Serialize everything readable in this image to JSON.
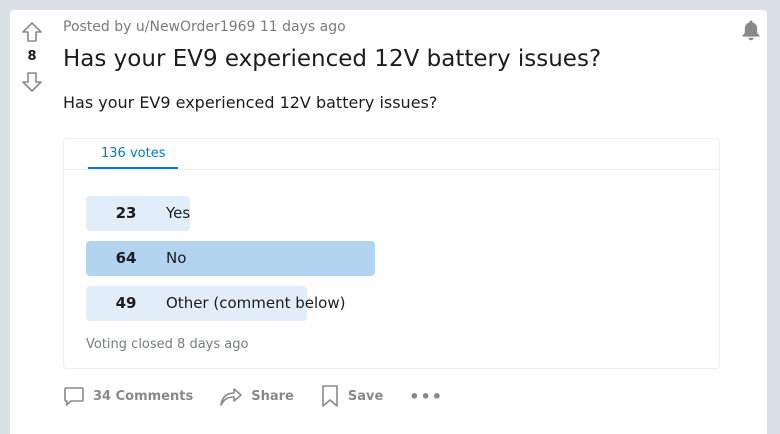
{
  "post": {
    "score": "8",
    "meta_prefix": "Posted by",
    "author": "u/NewOrder1969",
    "age": "11 days ago",
    "title": "Has your EV9 experienced 12V battery issues?",
    "body": "Has your EV9 experienced 12V battery issues?"
  },
  "poll": {
    "tab_label": "136 votes",
    "options": [
      {
        "count": "23",
        "label": "Yes",
        "fraction": 0.359
      },
      {
        "count": "64",
        "label": "No",
        "fraction": 1.0
      },
      {
        "count": "49",
        "label": "Other (comment below)",
        "fraction": 0.766
      }
    ],
    "status": "Voting closed 8 days ago"
  },
  "actions": {
    "comments": "34 Comments",
    "share": "Share",
    "save": "Save",
    "more": "•••"
  },
  "icons": {
    "upvote": "arrow-up-outline-icon",
    "downvote": "arrow-down-outline-icon",
    "bell": "bell-icon",
    "comment": "speech-bubble-icon",
    "share": "share-arrow-icon",
    "save": "bookmark-icon",
    "more": "ellipsis-icon"
  },
  "colors": {
    "page_bg": "#dae0e6",
    "accent": "#0079d3",
    "bar": "#e1eefa",
    "bar_leading": "#b2d4f0",
    "muted": "#787c7e"
  }
}
